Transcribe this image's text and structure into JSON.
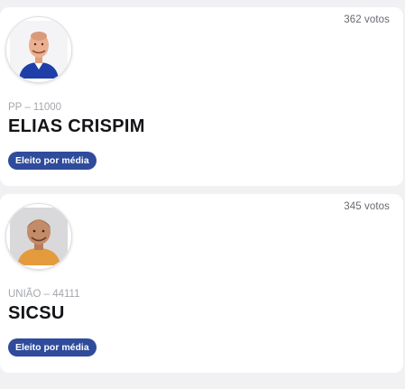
{
  "candidates": [
    {
      "votes": "362 votos",
      "party": "PP – 11000",
      "name": "ELIAS CRISPIM",
      "status": "Eleito por média",
      "photo_icon": "candidate-photo-elias-crispim"
    },
    {
      "votes": "345 votos",
      "party": "UNIÃO – 44111",
      "name": "SICSU",
      "status": "Eleito por média",
      "photo_icon": "candidate-photo-sicsu"
    }
  ],
  "colors": {
    "page_background": "#f1f1f3",
    "card_background": "#ffffff",
    "badge_background": "#2f4b9b",
    "badge_text": "#ffffff",
    "name_text": "#121417",
    "party_text": "#a3a7ad",
    "votes_text": "#666a70"
  }
}
